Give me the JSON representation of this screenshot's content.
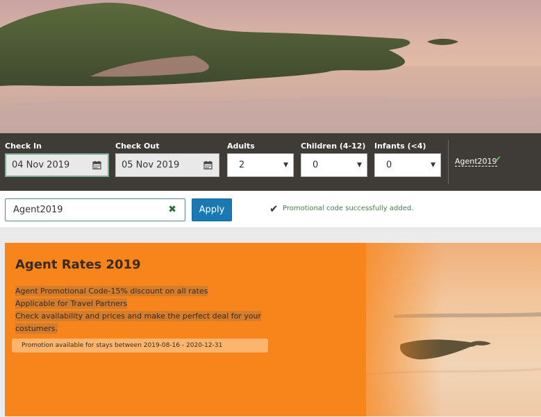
{
  "search": {
    "check_in": {
      "label": "Check In",
      "value": "04 Nov 2019"
    },
    "check_out": {
      "label": "Check Out",
      "value": "05 Nov 2019"
    },
    "adults": {
      "label": "Adults",
      "value": "2"
    },
    "children": {
      "label": "Children (4-12)",
      "value": "0"
    },
    "infants": {
      "label": "Infants (<4)",
      "value": "0"
    },
    "applied_code": "Agent2019"
  },
  "promo": {
    "code_value": "Agent2019",
    "apply_label": "Apply",
    "success_message": "Promotional code successfully added."
  },
  "offer": {
    "title": "Agent Rates 2019",
    "lines": [
      "Agent Promotional Code-15% discount on all rates",
      "Applicable for Travel Partners",
      "Check availability and prices and make the perfect deal for your",
      "costumers."
    ],
    "validity": "Promotion available for stays between 2019-08-16 - 2020-12-31"
  },
  "icons": {
    "calendar": "calendar-icon",
    "caret": "chevron-down-icon",
    "check": "check-icon",
    "clear": "clear-icon"
  },
  "colors": {
    "bar": "#3f3b37",
    "apply": "#1a79b3",
    "offer": "#f7851c",
    "success": "#4a7a4e"
  }
}
